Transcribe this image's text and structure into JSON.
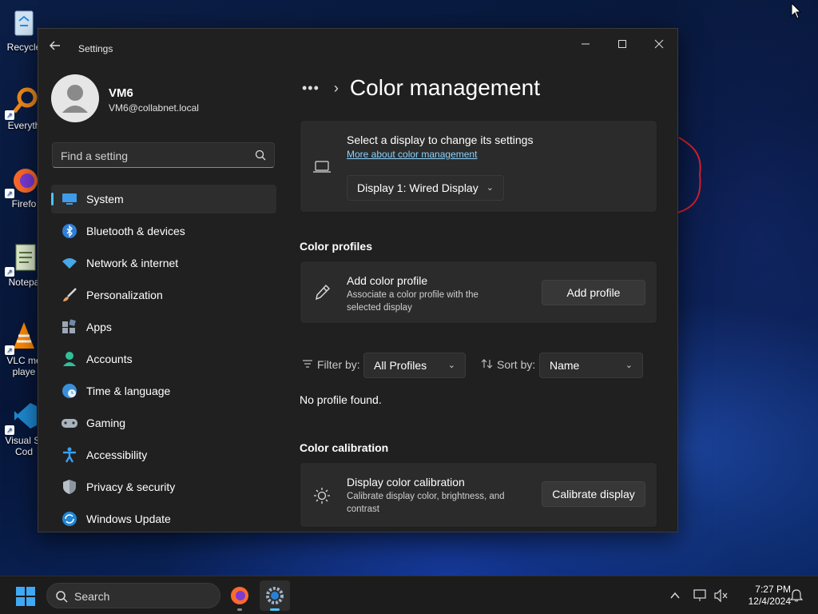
{
  "desktop": {
    "icons": [
      {
        "label": "Recycle",
        "icon": "recycle-bin-icon"
      },
      {
        "label": "Everyth",
        "icon": "everything-search-icon"
      },
      {
        "label": "Firefo",
        "icon": "firefox-icon"
      },
      {
        "label": "Notepa",
        "icon": "notepad-icon"
      },
      {
        "label": "VLC me\nplaye",
        "icon": "vlc-icon"
      },
      {
        "label": "Visual St\nCod",
        "icon": "vscode-icon"
      }
    ]
  },
  "window": {
    "title": "Settings",
    "controls": {
      "minimize": "minimize-icon",
      "maximize": "maximize-icon",
      "close": "close-icon"
    }
  },
  "user": {
    "name": "VM6",
    "email": "VM6@collabnet.local"
  },
  "search": {
    "placeholder": "Find a setting"
  },
  "nav": {
    "items": [
      {
        "label": "System",
        "icon": "monitor-icon",
        "active": true
      },
      {
        "label": "Bluetooth & devices",
        "icon": "bluetooth-icon"
      },
      {
        "label": "Network & internet",
        "icon": "wifi-icon"
      },
      {
        "label": "Personalization",
        "icon": "brush-icon"
      },
      {
        "label": "Apps",
        "icon": "apps-icon"
      },
      {
        "label": "Accounts",
        "icon": "person-icon"
      },
      {
        "label": "Time & language",
        "icon": "globe-clock-icon"
      },
      {
        "label": "Gaming",
        "icon": "gamepad-icon"
      },
      {
        "label": "Accessibility",
        "icon": "accessibility-icon"
      },
      {
        "label": "Privacy & security",
        "icon": "shield-icon"
      },
      {
        "label": "Windows Update",
        "icon": "update-icon"
      }
    ]
  },
  "main": {
    "breadcrumb_more": "•••",
    "page_title": "Color management",
    "display_card": {
      "title": "Select a display to change its settings",
      "link": "More about color management",
      "selected_display": "Display 1: Wired Display"
    },
    "color_profiles": {
      "heading": "Color profiles",
      "add_title": "Add color profile",
      "add_sub": "Associate a color profile with the selected display",
      "add_button": "Add profile",
      "filter_label": "Filter by:",
      "filter_value": "All Profiles",
      "sort_label": "Sort by:",
      "sort_value": "Name",
      "empty": "No profile found."
    },
    "color_calibration": {
      "heading": "Color calibration",
      "title": "Display color calibration",
      "sub": "Calibrate display color, brightness, and contrast",
      "button": "Calibrate display"
    }
  },
  "taskbar": {
    "search_label": "Search",
    "time": "7:27 PM",
    "date": "12/4/2024"
  },
  "colors": {
    "accent": "#4cc2ff",
    "window_bg": "#202020",
    "card_bg": "#2b2b2b"
  }
}
